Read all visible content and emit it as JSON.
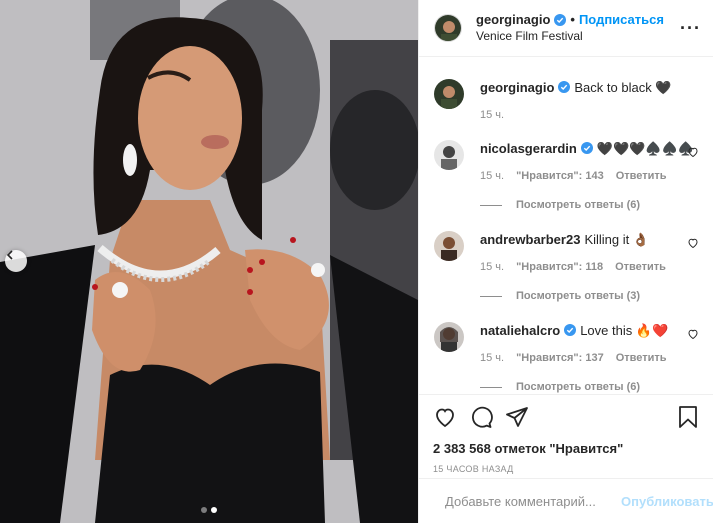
{
  "header": {
    "username": "georginagio",
    "separator": "•",
    "follow_label": "Подписаться",
    "location": "Venice Film Festival",
    "more_label": "···"
  },
  "caption": {
    "username": "georginagio",
    "text": "Back to black 🖤",
    "time": "15 ч."
  },
  "comments": [
    {
      "username": "nicolasgerardin",
      "text": "🖤🖤🖤♠️♠️♠️",
      "time": "15 ч.",
      "likes": "\"Нравится\": 143",
      "reply_label": "Ответить",
      "view_replies": "Посмотреть ответы (6)"
    },
    {
      "username": "andrewbarber23",
      "text": "Killing it 👌🏾",
      "time": "15 ч.",
      "likes": "\"Нравится\": 118",
      "reply_label": "Ответить",
      "view_replies": "Посмотреть ответы (3)"
    },
    {
      "username": "nataliehalcro",
      "text": "Love this 🔥❤️",
      "time": "15 ч.",
      "likes": "\"Нравится\": 137",
      "reply_label": "Ответить",
      "view_replies": "Посмотреть ответы (6)"
    }
  ],
  "actions": {
    "likes_text": "2 383 568 отметок \"Нравится\"",
    "date": "15 ЧАСОВ НАЗАД"
  },
  "composer": {
    "placeholder": "Добавьте комментарий...",
    "publish_label": "Опубликовать"
  },
  "carousel": {
    "slides": 2,
    "active": 1
  },
  "colors": {
    "accent": "#0095f6",
    "verified": "#3897f0",
    "muted": "#8e8e8e"
  },
  "icons": [
    "chevron-left-icon",
    "verified-icon",
    "more-icon",
    "heart-icon",
    "comment-icon",
    "share-icon",
    "bookmark-icon",
    "emoji-icon"
  ]
}
